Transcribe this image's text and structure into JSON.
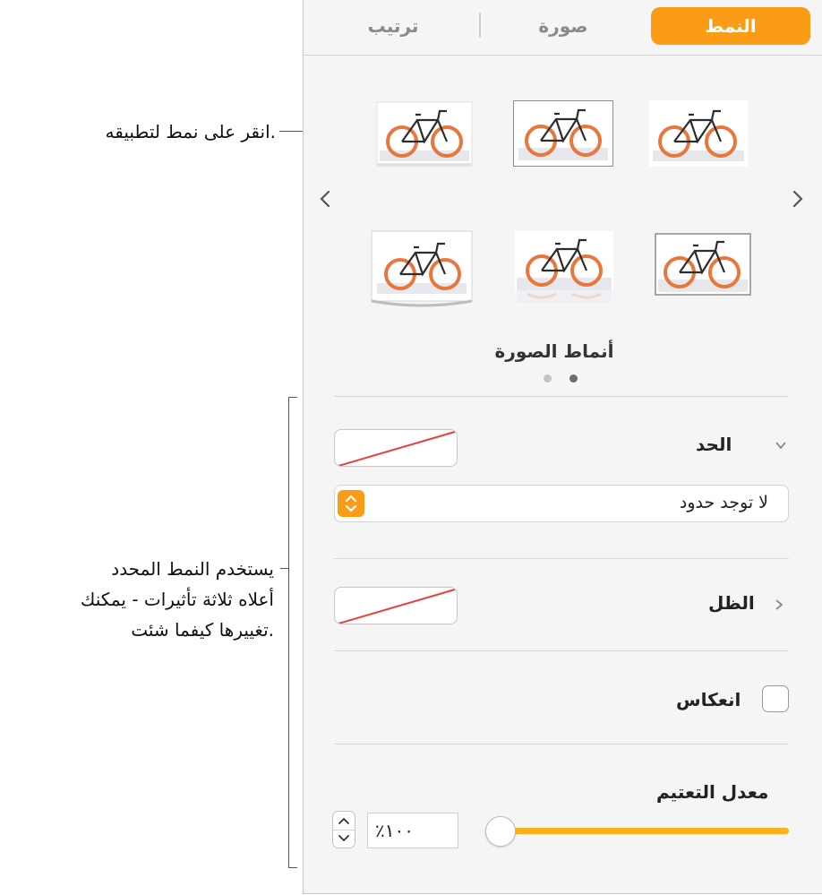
{
  "tabs": [
    {
      "label": "النمط",
      "active": true
    },
    {
      "label": "صورة",
      "active": false
    },
    {
      "label": "ترتيب",
      "active": false
    }
  ],
  "styles": {
    "caption": "أنماط الصورة",
    "page": 1,
    "page_count": 2
  },
  "border": {
    "label": "الحد",
    "popup_value": "لا توجد حدود"
  },
  "shadow": {
    "label": "الظل"
  },
  "reflection": {
    "label": "انعكاس",
    "checked": false
  },
  "opacity": {
    "label": "معدل التعتيم",
    "value": "٪١٠٠",
    "fraction": 1.0
  },
  "callouts": {
    "style_hint": "انقر على نمط لتطبيقه.",
    "effects_hint_line1": "يستخدم النمط المحدد",
    "effects_hint_line2": "أعلاه ثلاثة تأثيرات - يمكنك",
    "effects_hint_line3": "تغييرها كيفما شئت."
  },
  "colors": {
    "accent": "#fa9c16",
    "slider": "#fcb01a",
    "no_fill_line": "#e8403a"
  }
}
